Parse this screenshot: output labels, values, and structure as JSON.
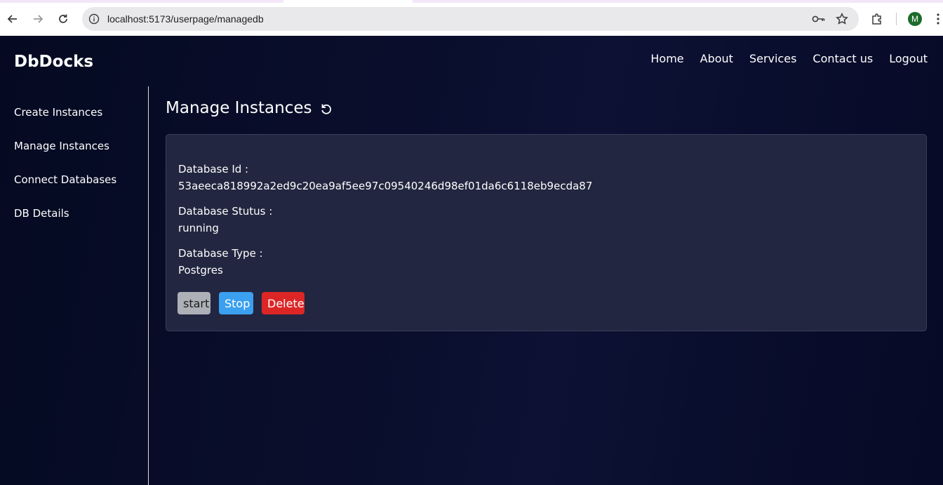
{
  "browser": {
    "url": "localhost:5173/userpage/managedb",
    "profile_initial": "M"
  },
  "app": {
    "brand": "DbDocks",
    "nav": [
      "Home",
      "About",
      "Services",
      "Contact us",
      "Logout"
    ]
  },
  "sidebar": {
    "items": [
      "Create Instances",
      "Manage Instances",
      "Connect Databases",
      "DB Details"
    ]
  },
  "main": {
    "title": "Manage Instances",
    "instance": {
      "id_label": "Database Id :",
      "id_value": "53aeeca818992a2ed9c20ea9af5ee97c09540246d98ef01da6c6118eb9ecda87",
      "status_label": "Database Stutus :",
      "status_value": "running",
      "type_label": "Database Type :",
      "type_value": "Postgres"
    },
    "buttons": {
      "start": "start",
      "stop": "Stop",
      "delete": "Delete"
    }
  },
  "colors": {
    "background": "#070b25",
    "card": "#222640",
    "start_button": "#aeb0b8",
    "stop_button": "#3aa0ef",
    "delete_button": "#dc2626"
  }
}
